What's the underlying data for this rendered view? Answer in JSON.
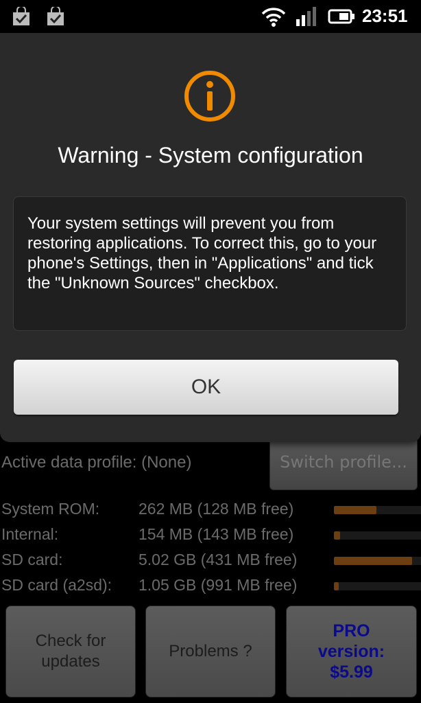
{
  "status_bar": {
    "time": "23:51",
    "icons": [
      "shopping-bag-check-icon",
      "shopping-bag-check-icon",
      "wifi-icon",
      "signal-icon",
      "battery-icon"
    ]
  },
  "dialog": {
    "icon": "info-icon",
    "title": "Warning - System configuration",
    "message": "Your system settings will prevent you from restoring applications. To correct this, go to your phone's Settings, then in \"Applications\" and tick the \"Unknown Sources\" checkbox.",
    "ok_label": "OK",
    "accent_color": "#f08a00"
  },
  "background": {
    "profile_label": "Active data profile:  (None)",
    "switch_profile_label": "Switch profile...",
    "storage": [
      {
        "label": "System ROM:",
        "value": "262 MB (128 MB free)",
        "used_fraction": 0.48
      },
      {
        "label": "Internal:",
        "value": "154 MB (143 MB free)",
        "used_fraction": 0.07
      },
      {
        "label": "SD card:",
        "value": "5.02 GB (431 MB free)",
        "used_fraction": 0.88
      },
      {
        "label": "SD card (a2sd):",
        "value": "1.05 GB (991 MB free)",
        "used_fraction": 0.05
      }
    ],
    "buttons": {
      "check_updates": "Check for updates",
      "problems": "Problems ?",
      "pro_version": "PRO version: $5.99"
    }
  }
}
